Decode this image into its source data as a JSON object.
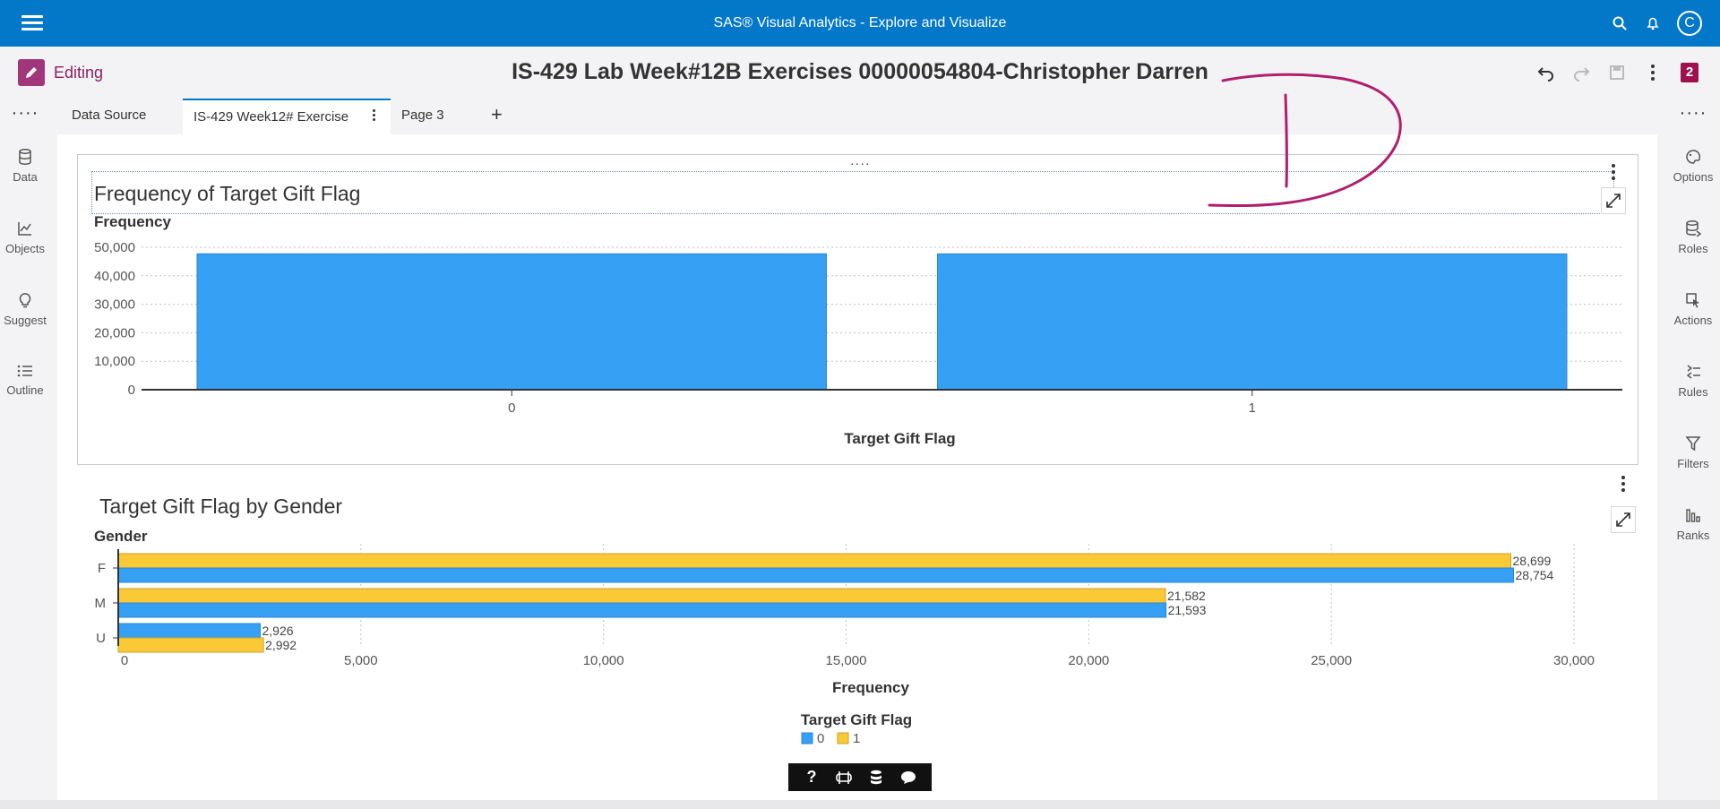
{
  "app": {
    "title": "SAS® Visual Analytics - Explore and Visualize",
    "user_initial": "C"
  },
  "header": {
    "mode_label": "Editing",
    "report_title": "IS-429 Lab Week#12B Exercises 00000054804-Christopher Darren",
    "badge_count": "2"
  },
  "left_rail": {
    "items": [
      {
        "label": "Data",
        "icon": "database-icon"
      },
      {
        "label": "Objects",
        "icon": "line-chart-icon"
      },
      {
        "label": "Suggest",
        "icon": "lightbulb-icon"
      },
      {
        "label": "Outline",
        "icon": "list-icon"
      }
    ]
  },
  "right_rail": {
    "items": [
      {
        "label": "Options",
        "icon": "palette-icon"
      },
      {
        "label": "Roles",
        "icon": "database-roles-icon"
      },
      {
        "label": "Actions",
        "icon": "pointer-icon"
      },
      {
        "label": "Rules",
        "icon": "rules-icon"
      },
      {
        "label": "Filters",
        "icon": "filter-icon"
      },
      {
        "label": "Ranks",
        "icon": "ranks-icon"
      }
    ]
  },
  "tabs": [
    {
      "label": "Data Source"
    },
    {
      "label": "IS-429 Week12# Exercise"
    },
    {
      "label": "Page 3"
    }
  ],
  "colors": {
    "series0": "#36a0f4",
    "series1": "#fcc936",
    "brand": "#0478c8",
    "edit": "#a0377a"
  },
  "chart_data": [
    {
      "type": "bar",
      "title": "Frequency of Target Gift Flag",
      "xlabel": "Target Gift Flag",
      "ylabel": "Frequency",
      "categories": [
        "0",
        "1"
      ],
      "values": [
        47697,
        47675
      ],
      "ylim": [
        0,
        50000
      ],
      "yticks": [
        "0",
        "10,000",
        "20,000",
        "30,000",
        "40,000",
        "50,000"
      ],
      "grid": true
    },
    {
      "type": "bar",
      "orientation": "horizontal",
      "title": "Target Gift Flag by Gender",
      "ylabel": "Gender",
      "xlabel": "Frequency",
      "categories": [
        "F",
        "M",
        "U"
      ],
      "series": [
        {
          "name": "0",
          "values": [
            28754,
            21593,
            2926
          ],
          "labels": [
            "28,754",
            "21,593",
            "2,926"
          ]
        },
        {
          "name": "1",
          "values": [
            28699,
            21582,
            2992
          ],
          "labels": [
            "28,699",
            "21,582",
            "2,992"
          ]
        }
      ],
      "xlim": [
        0,
        30000
      ],
      "xticks": [
        "0",
        "5,000",
        "10,000",
        "15,000",
        "20,000",
        "25,000",
        "30,000"
      ],
      "legend_title": "Target Gift Flag",
      "legend": "bottom-center",
      "grid": true
    }
  ]
}
